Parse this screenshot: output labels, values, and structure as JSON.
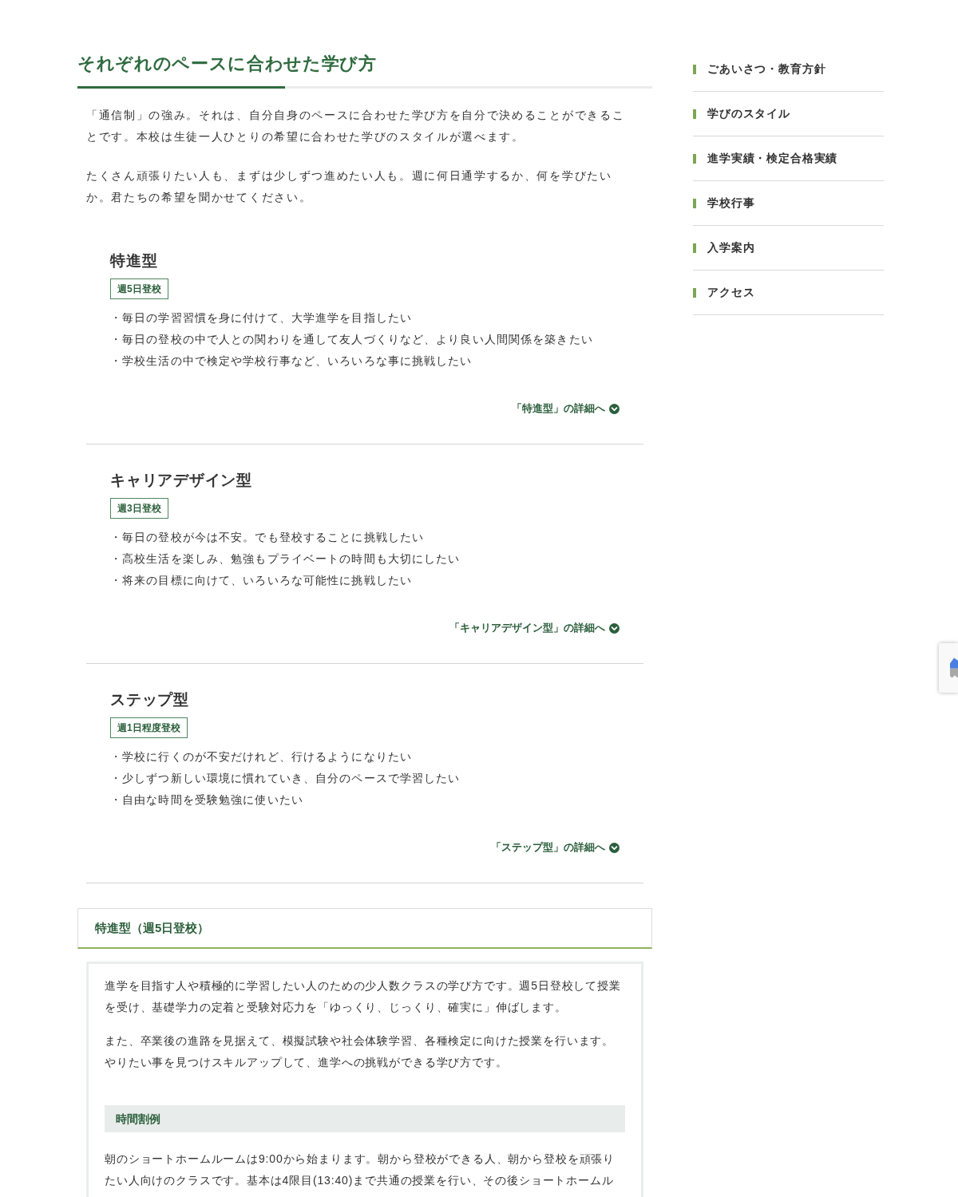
{
  "section": {
    "title": "それぞれのペースに合わせた学び方",
    "paragraphs": [
      "「通信制」の強み。それは、自分自身のペースに合わせた学び方を自分で決めることができることです。本校は生徒一人ひとりの希望に合わせた学びのスタイルが選べます。",
      "たくさん頑張りたい人も、まずは少しずつ進めたい人も。週に何日通学するか、何を学びたいか。君たちの希望を聞かせてください。"
    ]
  },
  "courses": [
    {
      "name": "特進型",
      "badge": "週5日登校",
      "points": [
        "・毎日の学習習慣を身に付けて、大学進学を目指したい",
        "・毎日の登校の中で人との関わりを通して友人づくりなど、より良い人間関係を築きたい",
        "・学校生活の中で検定や学校行事など、いろいろな事に挑戦したい"
      ],
      "link": "「特進型」の詳細へ"
    },
    {
      "name": "キャリアデザイン型",
      "badge": "週3日登校",
      "points": [
        "・毎日の登校が今は不安。でも登校することに挑戦したい",
        "・高校生活を楽しみ、勉強もプライベートの時間も大切にしたい",
        "・将来の目標に向けて、いろいろな可能性に挑戦したい"
      ],
      "link": "「キャリアデザイン型」の詳細へ"
    },
    {
      "name": "ステップ型",
      "badge": "週1日程度登校",
      "points": [
        "・学校に行くのが不安だけれど、行けるようになりたい",
        "・少しずつ新しい環境に慣れていき、自分のペースで学習したい",
        "・自由な時間を受験勉強に使いたい"
      ],
      "link": "「ステップ型」の詳細へ"
    }
  ],
  "detail": {
    "title": "特進型（週5日登校）",
    "paragraphs": [
      "進学を目指す人や積極的に学習したい人のための少人数クラスの学び方です。週5日登校して授業を受け、基礎学力の定着と受験対応力を「ゆっくり、じっくり、確実に」伸ばします。",
      "また、卒業後の進路を見据えて、模擬試験や社会体験学習、各種検定に向けた授業を行います。やりたい事を見つけスキルアップして、進学への挑戦ができる学び方です。"
    ],
    "subheading": "時間割例",
    "subparagraphs": [
      "朝のショートホームルームは9:00から始まります。朝から登校ができる人、朝から登校を頑張りたい人向けのクラスです。基本は4限目(13:40)まで共通の授業を行い、その後ショートホームル"
    ]
  },
  "sidebar": {
    "items": [
      {
        "label": "ごあいさつ・教育方針"
      },
      {
        "label": "学びのスタイル"
      },
      {
        "label": "進学実績・検定合格実績"
      },
      {
        "label": "学校行事"
      },
      {
        "label": "入学案内"
      },
      {
        "label": "アクセス"
      }
    ]
  }
}
